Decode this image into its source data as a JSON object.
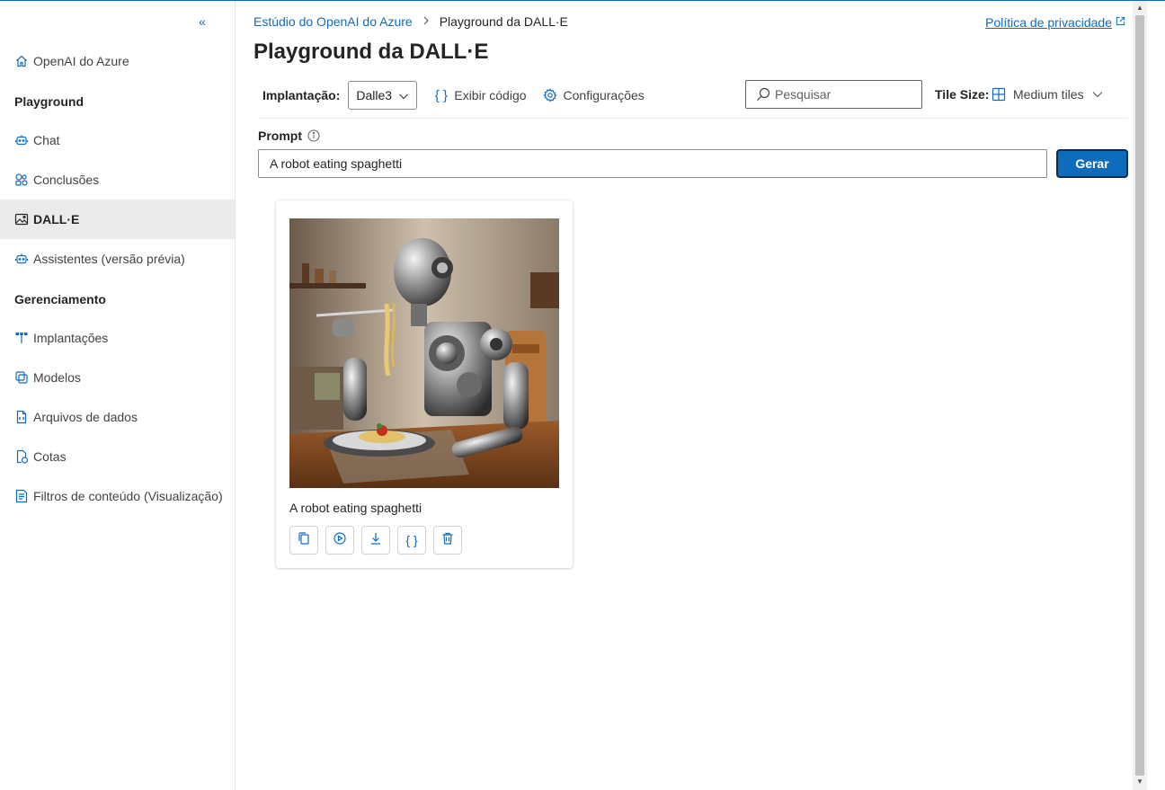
{
  "sidebar": {
    "items": [
      {
        "label": "OpenAI do Azure",
        "icon": "home-icon"
      },
      {
        "label": "Chat",
        "icon": "chat-bot-icon"
      },
      {
        "label": "Conclusões",
        "icon": "completions-icon"
      },
      {
        "label": "DALL·E",
        "icon": "image-icon",
        "active": true
      },
      {
        "label": "Assistentes (versão prévia)",
        "icon": "assistant-icon"
      },
      {
        "label": "Implantações",
        "icon": "deployments-icon"
      },
      {
        "label": "Modelos",
        "icon": "models-icon"
      },
      {
        "label": "Arquivos de dados",
        "icon": "data-files-icon"
      },
      {
        "label": "Cotas",
        "icon": "quota-icon"
      },
      {
        "label": "Filtros de conteúdo (Visualização)",
        "icon": "content-filter-icon"
      }
    ],
    "sections": {
      "playground": "Playground",
      "management": "Gerenciamento"
    },
    "collapse_icon": "double-chevron-left-icon"
  },
  "breadcrumb": {
    "root": "Estúdio do OpenAI do Azure",
    "current": "Playground da DALL·E"
  },
  "privacy_link": "Política de privacidade",
  "page_title": "Playground da DALL·E",
  "toolbar": {
    "deployment_label": "Implantação:",
    "deployment_value": "Dalle3",
    "view_code": "Exibir código",
    "settings": "Configurações",
    "search_placeholder": "Pesquisar",
    "tile_size_label": "Tile Size:",
    "tile_size_value": "Medium tiles"
  },
  "prompt": {
    "label": "Prompt",
    "value": "A robot eating spaghetti",
    "generate_button": "Gerar"
  },
  "results": [
    {
      "caption": "A robot eating spaghetti",
      "image_desc": "metallic robot eating spaghetti at a wooden table",
      "actions": [
        "copy-icon",
        "regenerate-icon",
        "download-icon",
        "code-icon",
        "delete-icon"
      ]
    }
  ],
  "colors": {
    "accent": "#0f6cbd",
    "active_nav_bg": "#ebebeb"
  }
}
